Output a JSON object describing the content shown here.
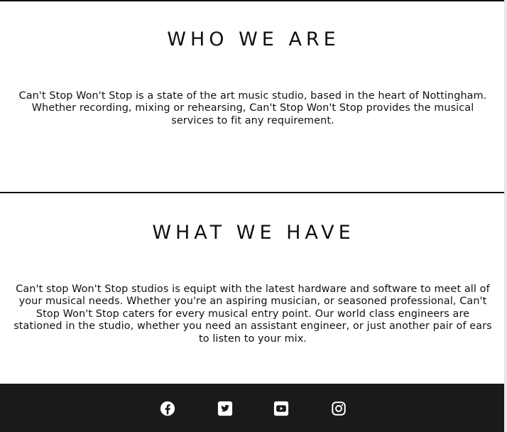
{
  "who_we_are": {
    "heading": "WHO WE ARE",
    "body": "Can't Stop Won't Stop is a state of the art music studio, based in the heart of Nottingham. Whether recording, mixing or rehearsing, Can't Stop Won't Stop provides the musical services to fit any requirement."
  },
  "what_we_have": {
    "heading": "WHAT WE HAVE",
    "body": "Can't stop Won't Stop studios is equipt with the latest hardware and software to meet all of your musical needs. Whether you're an aspiring musician, or seasoned professional, Can't Stop Won't Stop caters for every musical entry point. Our world class engineers are stationed in the studio, whether you need an assistant engineer, or just another pair of ears to listen to your mix."
  },
  "footer": {
    "background": "#1a1a1a",
    "icon_color": "#ffffff",
    "social_links": [
      {
        "icon": "facebook-icon"
      },
      {
        "icon": "twitter-icon"
      },
      {
        "icon": "youtube-icon"
      },
      {
        "icon": "instagram-icon"
      }
    ]
  }
}
